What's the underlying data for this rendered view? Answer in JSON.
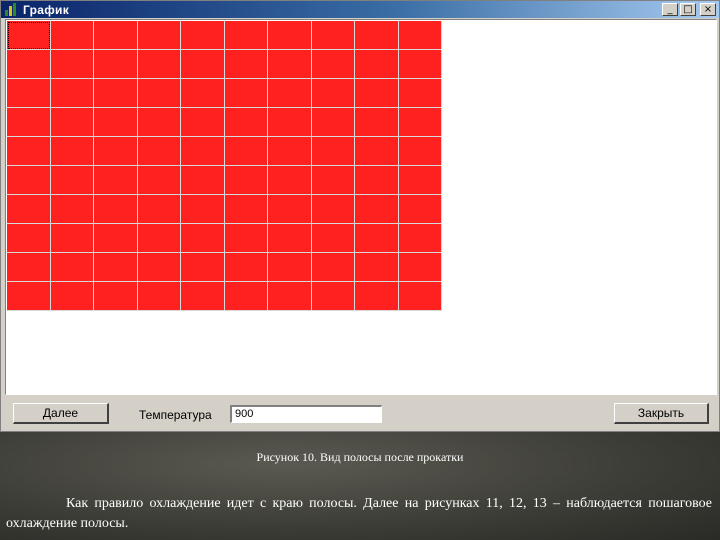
{
  "window": {
    "title": "График",
    "controls": {
      "minimize": "_",
      "maximize": "□",
      "close": "×"
    }
  },
  "grid": {
    "rows": 10,
    "columns": 10,
    "cell_color": "#ff2020",
    "selected_cell": [
      0,
      0
    ]
  },
  "panel": {
    "next_button": "Далее",
    "temperature_label": "Температура",
    "temperature_value": "900",
    "close_button": "Закрыть"
  },
  "slide": {
    "caption": "Рисунок 10. Вид полосы после прокатки",
    "paragraph": "Как правило охлаждение идет с краю полосы. Далее на рисунках 11, 12, 13 – наблюдается пошаговое охлаждение полосы."
  },
  "colors": {
    "title_gradient_start": "#0a246a",
    "title_gradient_end": "#a6caf0",
    "strip": "#ff2020"
  }
}
